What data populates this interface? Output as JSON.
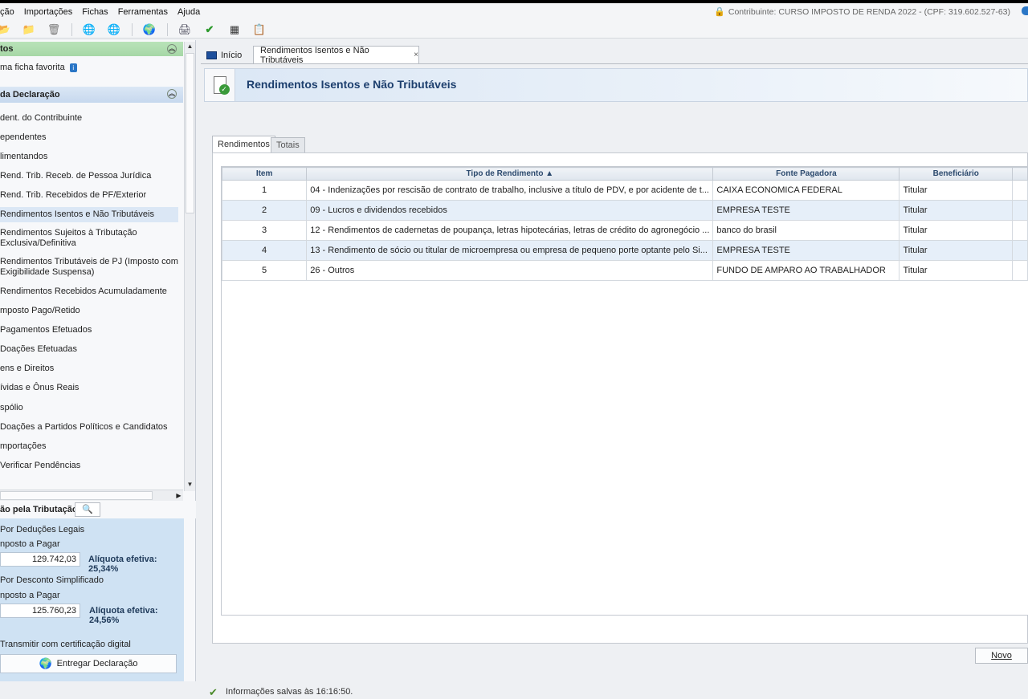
{
  "menu": [
    "ção",
    "Importações",
    "Fichas",
    "Ferramentas",
    "Ajuda"
  ],
  "contribuinte": "Contribuinte: CURSO IMPOSTO DE RENDA 2022 - (CPF: 319.602.527-63)",
  "toolbar_icons": [
    "open-folder-icon",
    "folder-icon",
    "trash-icon",
    "globe-receive-icon",
    "globe-send-icon",
    "network-icon",
    "print-icon",
    "check-icon",
    "calculator-icon",
    "clipboard-icon"
  ],
  "left": {
    "favorites_title": "tos",
    "favorite_item": "ma ficha favorita",
    "declaration_title": " da Declaração",
    "nav": [
      "dent. do Contribuinte",
      "ependentes",
      "limentandos",
      "Rend. Trib. Receb. de Pessoa Jurídica",
      "Rend. Trib. Recebidos de PF/Exterior",
      "Rendimentos Isentos e Não Tributáveis",
      "Rendimentos Sujeitos à Tributação\nExclusiva/Definitiva",
      "Rendimentos Tributáveis de PJ (Imposto com\nExigibilidade Suspensa)",
      "Rendimentos Recebidos Acumuladamente",
      "mposto Pago/Retido",
      "Pagamentos Efetuados",
      "Doações Efetuadas",
      "ens e Direitos",
      "ívidas e Ônus Reais",
      "spólio",
      "Doações a Partidos Políticos e Candidatos",
      "mportações",
      "Verificar Pendências"
    ],
    "trib_title": "ão pela Tributação:",
    "deducoes_label": "Por Deduções Legais",
    "imposto_label_1": "nposto a Pagar",
    "valor_1": "129.742,03",
    "aliquota_1": "Alíquota efetiva: 25,34%",
    "simplificado_label": "Por Desconto Simplificado",
    "imposto_label_2": "nposto a Pagar",
    "valor_2": "125.760,23",
    "aliquota_2": "Alíquota efetiva: 24,56%",
    "transmitir_label": "Transmitir com certificação digital",
    "entregar_label": "Entregar Declaração"
  },
  "main": {
    "tab_home": "Início",
    "tab_active": "Rendimentos Isentos e Não Tributáveis",
    "tab_close": "×",
    "banner_title": "Rendimentos Isentos e Não Tributáveis",
    "subtab_1": "Rendimentos",
    "subtab_2": "Totais",
    "columns": [
      "Item",
      "Tipo de Rendimento ▲",
      "Fonte Pagadora",
      "Beneficiário"
    ],
    "rows": [
      {
        "item": "1",
        "tipo": "04 - Indenizações por rescisão de contrato de trabalho, inclusive a título de PDV, e por acidente de t...",
        "fonte": "CAIXA ECONOMICA FEDERAL",
        "benef": "Titular"
      },
      {
        "item": "2",
        "tipo": "09 - Lucros e dividendos recebidos",
        "fonte": "EMPRESA TESTE",
        "benef": "Titular"
      },
      {
        "item": "3",
        "tipo": "12 - Rendimentos de cadernetas de poupança, letras hipotecárias, letras de crédito do agronegócio ...",
        "fonte": "banco do brasil",
        "benef": "Titular"
      },
      {
        "item": "4",
        "tipo": "13 - Rendimento de sócio ou titular de microempresa ou empresa de pequeno porte optante pelo Si...",
        "fonte": "EMPRESA TESTE",
        "benef": "Titular"
      },
      {
        "item": "5",
        "tipo": "26 - Outros",
        "fonte": "FUNDO DE AMPARO AO TRABALHADOR",
        "benef": "Titular"
      }
    ],
    "novo_label": "Novo",
    "status": "Informações salvas às 16:16:50."
  }
}
